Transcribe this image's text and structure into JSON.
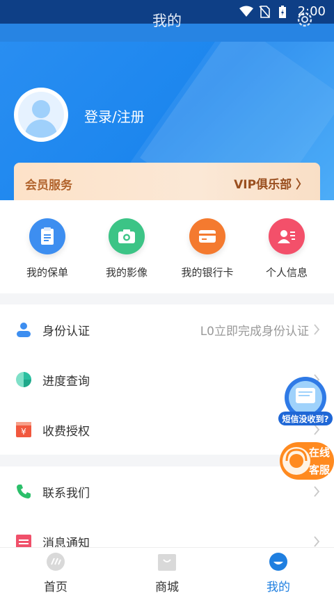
{
  "status_bar": {
    "time": "2:00"
  },
  "header": {
    "title": "我的",
    "login_text": "登录/注册"
  },
  "vip": {
    "left_label": "会员服务",
    "right_label": "VIP俱乐部 〉"
  },
  "quick_actions": [
    {
      "label": "我的保单",
      "icon": "document-icon",
      "color": "#3d8ef0"
    },
    {
      "label": "我的影像",
      "icon": "camera-icon",
      "color": "#3cc486"
    },
    {
      "label": "我的银行卡",
      "icon": "card-icon",
      "color": "#f47a2f"
    },
    {
      "label": "个人信息",
      "icon": "person-info-icon",
      "color": "#f3506a"
    }
  ],
  "group1": [
    {
      "label": "身份认证",
      "right": "L0立即完成身份认证",
      "icon": "user-icon"
    },
    {
      "label": "进度查询",
      "right": "",
      "icon": "progress-icon"
    },
    {
      "label": "收费授权",
      "right": "",
      "icon": "fee-icon"
    }
  ],
  "group2": [
    {
      "label": "联系我们",
      "right": "",
      "icon": "phone-icon"
    },
    {
      "label": "消息通知",
      "right": "",
      "icon": "message-icon"
    }
  ],
  "floating": {
    "sms_text": "短信没收到?",
    "cs_line1": "在线",
    "cs_line2": "客服"
  },
  "tabs": [
    {
      "label": "首页",
      "icon": "home-icon"
    },
    {
      "label": "商城",
      "icon": "mall-icon"
    },
    {
      "label": "我的",
      "icon": "mine-icon",
      "active": true
    }
  ]
}
